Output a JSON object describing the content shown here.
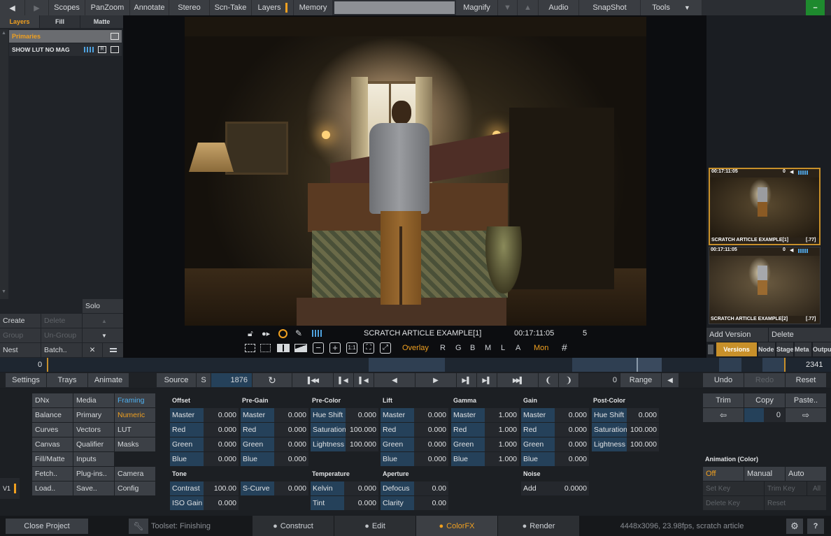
{
  "menu": {
    "scopes": "Scopes",
    "panzoom": "PanZoom",
    "annotate": "Annotate",
    "stereo": "Stereo",
    "scntake": "Scn-Take",
    "layers": "Layers",
    "memory": "Memory",
    "magnify": "Magnify",
    "audio": "Audio",
    "snapshot": "SnapShot",
    "tools": "Tools",
    "minimize": "–"
  },
  "left_panel": {
    "tabs": [
      "Layers",
      "Fill",
      "Matte"
    ],
    "group_label": "Primaries",
    "layer_name": "SHOW LUT NO MAG",
    "layer_r_badge": "R",
    "solo": "Solo",
    "create": "Create",
    "delete": "Delete",
    "group": "Group",
    "ungroup": "Un-Group",
    "nest": "Nest",
    "batch": "Batch..",
    "close_glyph": "✕"
  },
  "viewer": {
    "clip_name": "SCRATCH ARTICLE EXAMPLE[1]",
    "timecode": "00:17:11:05",
    "frame_count": "5",
    "overlay": "Overlay",
    "channels": [
      "R",
      "G",
      "B",
      "M",
      "L",
      "A"
    ],
    "mon": "Mon"
  },
  "versions": {
    "thumbs": [
      {
        "timecode": "00:17:11:05",
        "num": "0",
        "name": "SCRATCH ARTICLE EXAMPLE[1]",
        "suffix": "[.77]"
      },
      {
        "timecode": "00:17:11:05",
        "num": "0",
        "name": "SCRATCH ARTICLE EXAMPLE[2]",
        "suffix": "[.77]"
      }
    ],
    "add_version": "Add Version",
    "delete": "Delete",
    "tabs": [
      "Versions",
      "Node",
      "Stage",
      "Meta",
      "Output"
    ]
  },
  "timeline": {
    "start": "0",
    "end": "2341"
  },
  "transport": {
    "settings": "Settings",
    "trays": "Trays",
    "animate": "Animate",
    "source": "Source",
    "s": "S",
    "frame": "1876",
    "zero": "0",
    "range": "Range",
    "undo": "Undo",
    "redo": "Redo",
    "reset": "Reset"
  },
  "toolset_menu": {
    "col1": [
      "DNx",
      "Balance",
      "Curves",
      "Canvas",
      "Fill/Matte",
      "Fetch..",
      "Load.."
    ],
    "col2": [
      "Media",
      "Primary",
      "Vectors",
      "Qualifier",
      "Inputs",
      "Plug-ins..",
      "Save.."
    ],
    "col3": [
      "Framing",
      "Numeric",
      "LUT",
      "Masks",
      "",
      "Camera",
      "Config"
    ],
    "v1": "V1"
  },
  "numeric": {
    "offset": {
      "title": "Offset",
      "rows": [
        [
          "Master",
          "0.000"
        ],
        [
          "Red",
          "0.000"
        ],
        [
          "Green",
          "0.000"
        ],
        [
          "Blue",
          "0.000"
        ]
      ]
    },
    "pregain": {
      "title": "Pre-Gain",
      "rows": [
        [
          "Master",
          "0.000"
        ],
        [
          "Red",
          "0.000"
        ],
        [
          "Green",
          "0.000"
        ],
        [
          "Blue",
          "0.000"
        ]
      ]
    },
    "precolor": {
      "title": "Pre-Color",
      "rows": [
        [
          "Hue Shift",
          "0.000"
        ],
        [
          "Saturation",
          "100.000"
        ],
        [
          "Lightness",
          "100.000"
        ]
      ]
    },
    "lift": {
      "title": "Lift",
      "rows": [
        [
          "Master",
          "0.000"
        ],
        [
          "Red",
          "0.000"
        ],
        [
          "Green",
          "0.000"
        ],
        [
          "Blue",
          "0.000"
        ]
      ]
    },
    "gamma": {
      "title": "Gamma",
      "rows": [
        [
          "Master",
          "1.000"
        ],
        [
          "Red",
          "1.000"
        ],
        [
          "Green",
          "1.000"
        ],
        [
          "Blue",
          "1.000"
        ]
      ]
    },
    "gain": {
      "title": "Gain",
      "rows": [
        [
          "Master",
          "0.000"
        ],
        [
          "Red",
          "0.000"
        ],
        [
          "Green",
          "0.000"
        ],
        [
          "Blue",
          "0.000"
        ]
      ]
    },
    "postcolor": {
      "title": "Post-Color",
      "rows": [
        [
          "Hue Shift",
          "0.000"
        ],
        [
          "Saturation",
          "100.000"
        ],
        [
          "Lightness",
          "100.000"
        ]
      ]
    },
    "tone": {
      "title": "Tone",
      "rows": [
        [
          "Contrast",
          "100.00"
        ],
        [
          "ISO Gain",
          "0.000"
        ]
      ],
      "scurve": [
        "S-Curve",
        "0.000"
      ]
    },
    "temperature": {
      "title": "Temperature",
      "rows": [
        [
          "Kelvin",
          "0.000"
        ],
        [
          "Tint",
          "0.000"
        ]
      ]
    },
    "aperture": {
      "title": "Aperture",
      "rows": [
        [
          "Defocus",
          "0.00"
        ],
        [
          "Clarity",
          "0.00"
        ]
      ]
    },
    "noise": {
      "title": "Noise",
      "rows": [
        [
          "Add",
          "0.0000"
        ]
      ]
    }
  },
  "right_tools": {
    "trim": "Trim",
    "copy": "Copy",
    "paste": "Paste..",
    "copy_value": "0",
    "animation_title": "Animation (Color)",
    "off": "Off",
    "manual": "Manual",
    "auto": "Auto",
    "set_key": "Set Key",
    "trim_key": "Trim Key",
    "all": "All",
    "delete_key": "Delete Key",
    "reset": "Reset"
  },
  "bottom": {
    "close_project": "Close Project",
    "toolset": "Toolset: Finishing",
    "construct": "Construct",
    "edit": "Edit",
    "colorfx": "ColorFX",
    "render": "Render",
    "info": "4448x3096, 23.98fps, scratch article",
    "help": "?"
  },
  "colors": {
    "accent": "#f0a020",
    "field_blue": "#25415a",
    "versions_tab": "#c8902a",
    "green": "#1e8a2e"
  }
}
